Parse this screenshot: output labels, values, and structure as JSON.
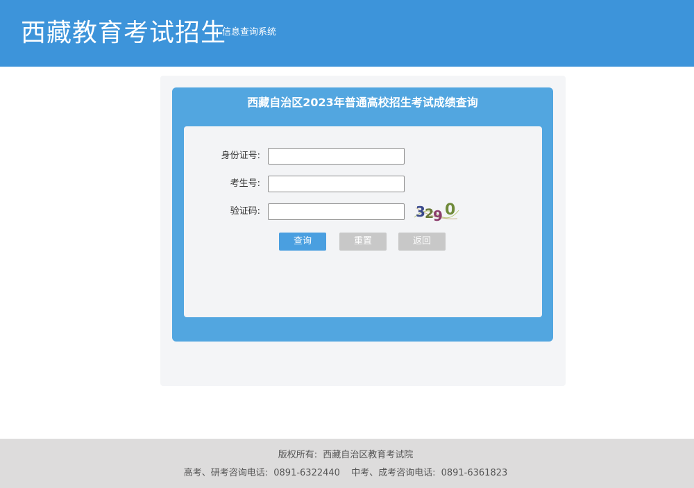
{
  "header": {
    "site_title": "西藏教育考试招生",
    "site_subtitle": "信息查询系统",
    "background_color": "#3d94da"
  },
  "card": {
    "title": "西藏自治区2023年普通高校招生考试成绩查询",
    "accent_color": "#52a6e0"
  },
  "form": {
    "id_label": "身份证号:",
    "id_value": "",
    "exam_no_label": "考生号:",
    "exam_no_value": "",
    "captcha_label": "验证码:",
    "captcha_value": "",
    "captcha_image": {
      "icon": "captcha-image",
      "text": "3290"
    }
  },
  "buttons": {
    "query_label": "查询",
    "reset_label": "重置",
    "back_label": "返回"
  },
  "footer": {
    "copyright_label": "版权所有:",
    "copyright_owner": "西藏自治区教育考试院",
    "gaokao_label": "高考、研考咨询电话:",
    "gaokao_phone": "0891-6322440",
    "zhongkao_label": "中考、成考咨询电话:",
    "zhongkao_phone": "0891-6361823"
  }
}
